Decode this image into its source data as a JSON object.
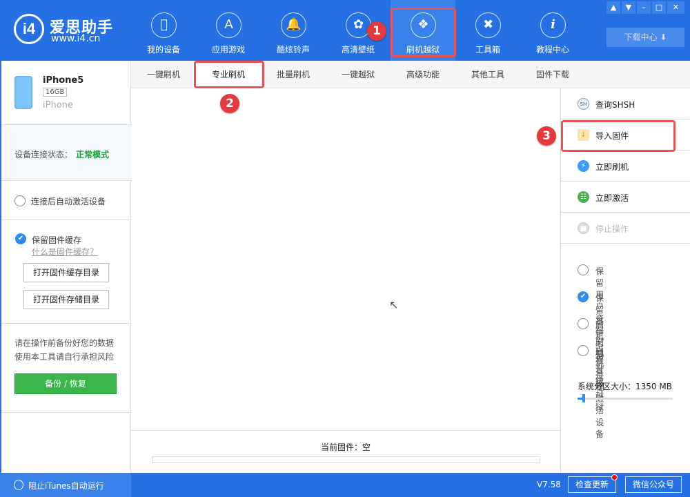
{
  "app": {
    "logo_mark": "i4",
    "title": "爱思助手",
    "url": "www.i4.cn"
  },
  "nav": [
    {
      "label": "我的设备",
      "icon": "apple-icon"
    },
    {
      "label": "应用游戏",
      "icon": "app-store-icon"
    },
    {
      "label": "酷炫铃声",
      "icon": "bell-icon"
    },
    {
      "label": "高清壁纸",
      "icon": "flower-icon"
    },
    {
      "label": "刷机越狱",
      "icon": "box-icon",
      "active": true
    },
    {
      "label": "工具箱",
      "icon": "tools-icon"
    },
    {
      "label": "教程中心",
      "icon": "info-icon"
    }
  ],
  "download_center": "下载中心",
  "annotations": [
    "1",
    "2",
    "3"
  ],
  "device": {
    "name": "iPhone5",
    "capacity": "16GB",
    "type": "iPhone",
    "status_label": "设备连接状态：",
    "status_value": "正常模式"
  },
  "sidebar": {
    "auto_activate": "连接后自动激活设备",
    "keep_cache": "保留固件缓存",
    "what_is_cache": "什么是固件缓存？",
    "open_cache_dir": "打开固件缓存目录",
    "open_storage_dir": "打开固件存储目录",
    "warning_line1": "请在操作前备份好您的数据",
    "warning_line2": "使用本工具请自行承担风险",
    "backup_button": "备份 / 恢复"
  },
  "tabs": [
    "一键刷机",
    "专业刷机",
    "批量刷机",
    "一键越狱",
    "高级功能",
    "其他工具",
    "固件下载"
  ],
  "main": {
    "current_firmware": "当前固件：空",
    "progress": 0
  },
  "actions": [
    {
      "label": "查询SHSH",
      "icon": "shsh-search-icon"
    },
    {
      "label": "导入固件",
      "icon": "import-folder-icon"
    },
    {
      "label": "立即刷机",
      "icon": "lightning-icon"
    },
    {
      "label": "立即激活",
      "icon": "globe-icon"
    },
    {
      "label": "停止操作",
      "icon": "stop-icon",
      "disabled": true
    }
  ],
  "options": [
    {
      "label": "保留用户资料刷机",
      "checked": false
    },
    {
      "label": "保留基带不被升级",
      "checked": true
    },
    {
      "label": "刷机过程直接越狱",
      "checked": false
    },
    {
      "label": "刷机过程激活设备",
      "checked": false
    }
  ],
  "partition": {
    "label": "系统分区大小：1350 MB",
    "value_mb": 1350
  },
  "footer": {
    "itunes_block": "阻止iTunes自动运行",
    "version": "V7.58",
    "check_update": "检查更新",
    "wechat": "微信公众号"
  }
}
